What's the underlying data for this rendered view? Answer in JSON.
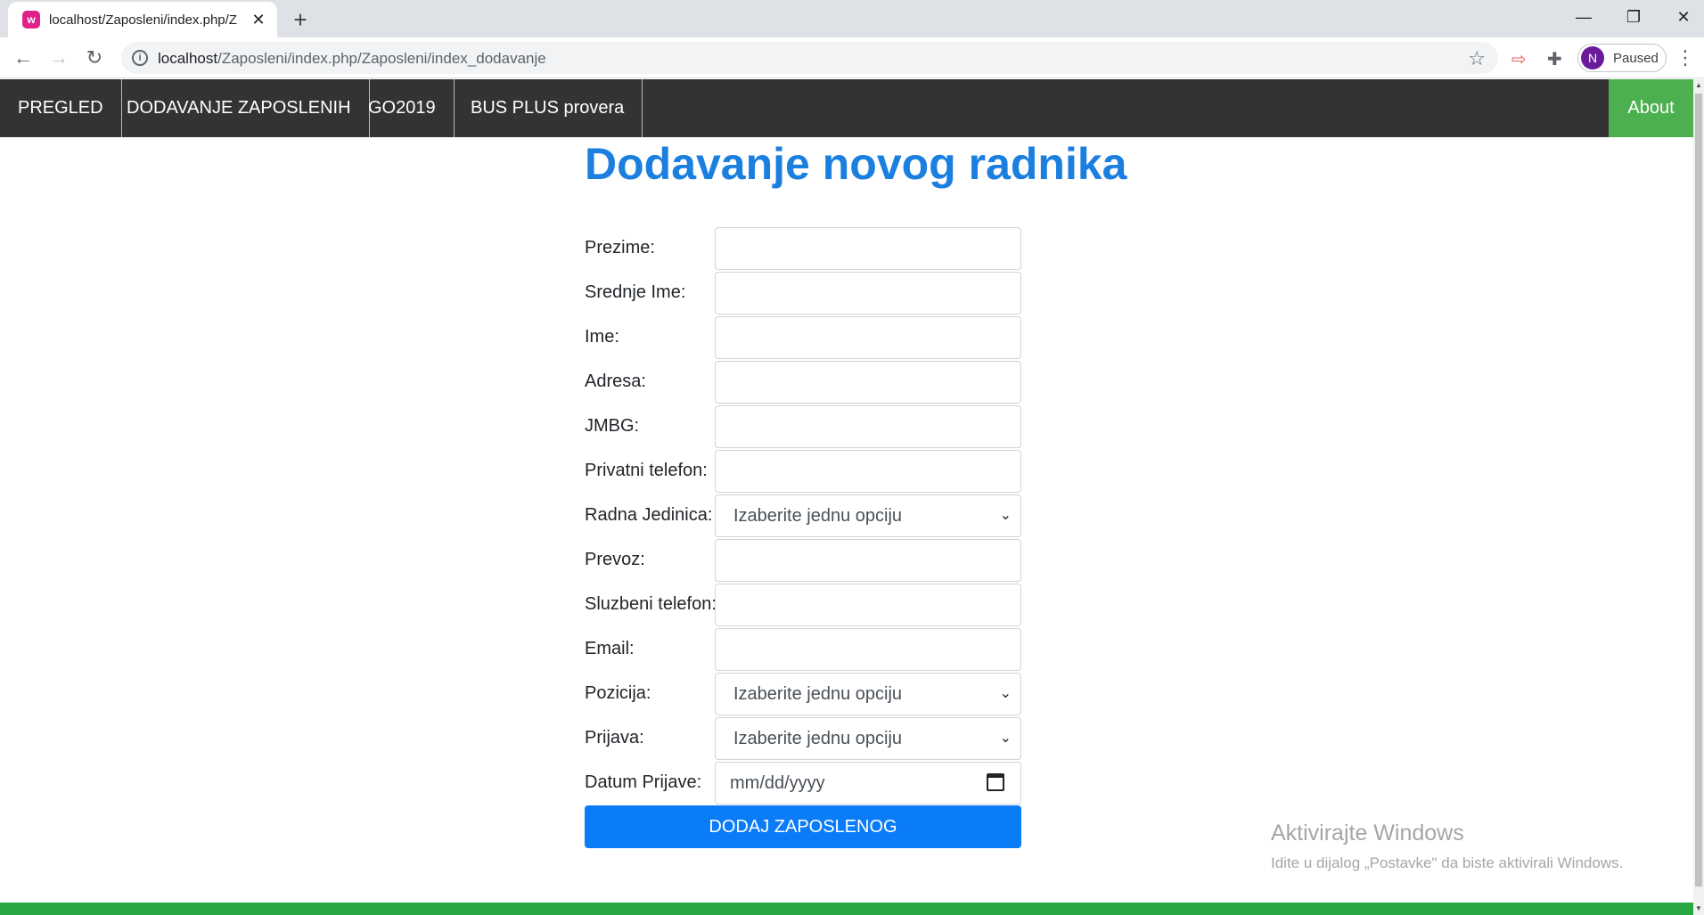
{
  "browser": {
    "tab_title": "localhost/Zaposleni/index.php/Z",
    "favicon_letter": "w",
    "url_host": "localhost",
    "url_path": "/Zaposleni/index.php/Zaposleni/index_dodavanje",
    "profile_initial": "N",
    "profile_status": "Paused"
  },
  "navbar": {
    "items": [
      {
        "label": "PREGLED"
      },
      {
        "label": "DODAVANJE ZAPOSLENIH"
      },
      {
        "label": "GO2019"
      },
      {
        "label": "BUS PLUS provera"
      }
    ],
    "about_label": "About"
  },
  "page": {
    "title": "Dodavanje novog radnika"
  },
  "form": {
    "fields": [
      {
        "label": "Prezime:",
        "type": "text",
        "value": ""
      },
      {
        "label": "Srednje Ime:",
        "type": "text",
        "value": ""
      },
      {
        "label": "Ime:",
        "type": "text",
        "value": ""
      },
      {
        "label": "Adresa:",
        "type": "text",
        "value": ""
      },
      {
        "label": "JMBG:",
        "type": "text",
        "value": ""
      },
      {
        "label": "Privatni telefon:",
        "type": "text",
        "value": ""
      },
      {
        "label": "Radna Jedinica:",
        "type": "select",
        "value": "Izaberite jednu opciju"
      },
      {
        "label": "Prevoz:",
        "type": "text",
        "value": ""
      },
      {
        "label": "Sluzbeni telefon:",
        "type": "text",
        "value": ""
      },
      {
        "label": "Email:",
        "type": "text",
        "value": ""
      },
      {
        "label": "Pozicija:",
        "type": "select",
        "value": "Izaberite jednu opciju"
      },
      {
        "label": "Prijava:",
        "type": "select",
        "value": "Izaberite jednu opciju"
      },
      {
        "label": "Datum Prijave:",
        "type": "date",
        "value": "mm/dd/yyyy"
      }
    ],
    "submit_label": "DODAJ ZAPOSLENOG"
  },
  "watermark": {
    "title": "Aktivirajte Windows",
    "subtitle": "Idite u dijalog „Postavke\" da biste aktivirali Windows."
  },
  "colors": {
    "navbar_bg": "#333333",
    "about_bg": "#4caf50",
    "title": "#1b7fe0",
    "submit_bg": "#0a7cf8",
    "footer": "#28a745"
  }
}
